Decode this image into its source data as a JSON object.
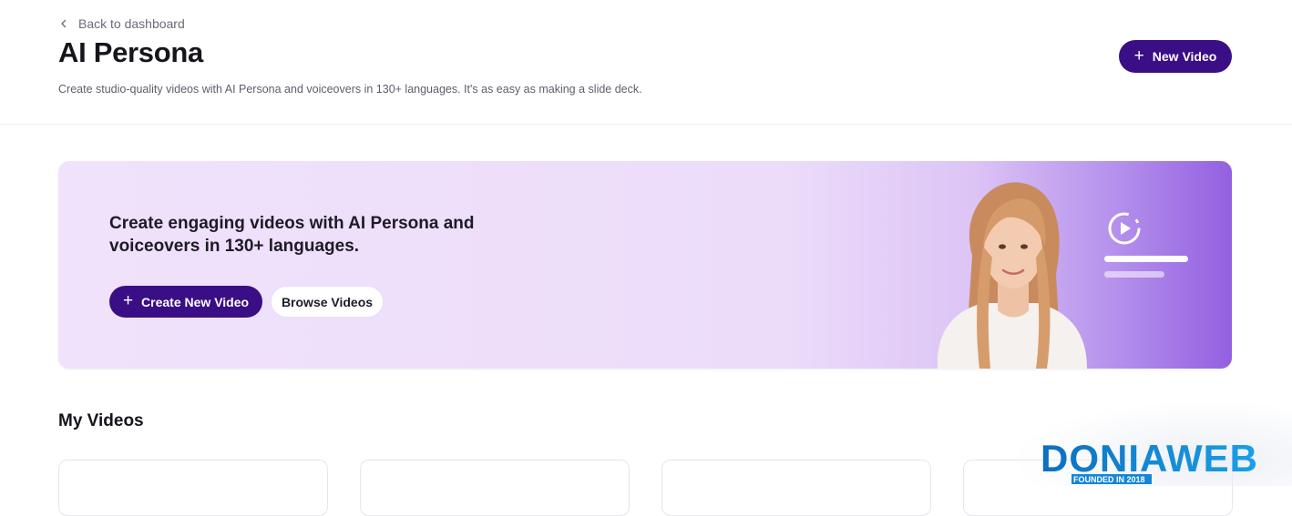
{
  "header": {
    "back_label": "Back to dashboard",
    "title": "AI Persona",
    "subtitle": "Create studio-quality videos with AI Persona and voiceovers in 130+ languages. It's as easy as making a slide deck.",
    "new_video_label": "New Video"
  },
  "hero": {
    "heading": "Create engaging videos with AI Persona and voiceovers in 130+ languages.",
    "create_label": "Create New Video",
    "browse_label": "Browse Videos"
  },
  "my_videos": {
    "title": "My Videos",
    "card_count": 4
  },
  "watermark": {
    "brand": "DONIAWEB",
    "tagline": "FOUNDED IN 2018"
  },
  "colors": {
    "primary": "#3a0e84",
    "hero_bg": "#f0e2fb",
    "hero_accent": "#9360e0",
    "watermark_blue": "#1586d6"
  },
  "icons": [
    "chevron-left-icon",
    "plus-icon",
    "play-circle-icon"
  ]
}
